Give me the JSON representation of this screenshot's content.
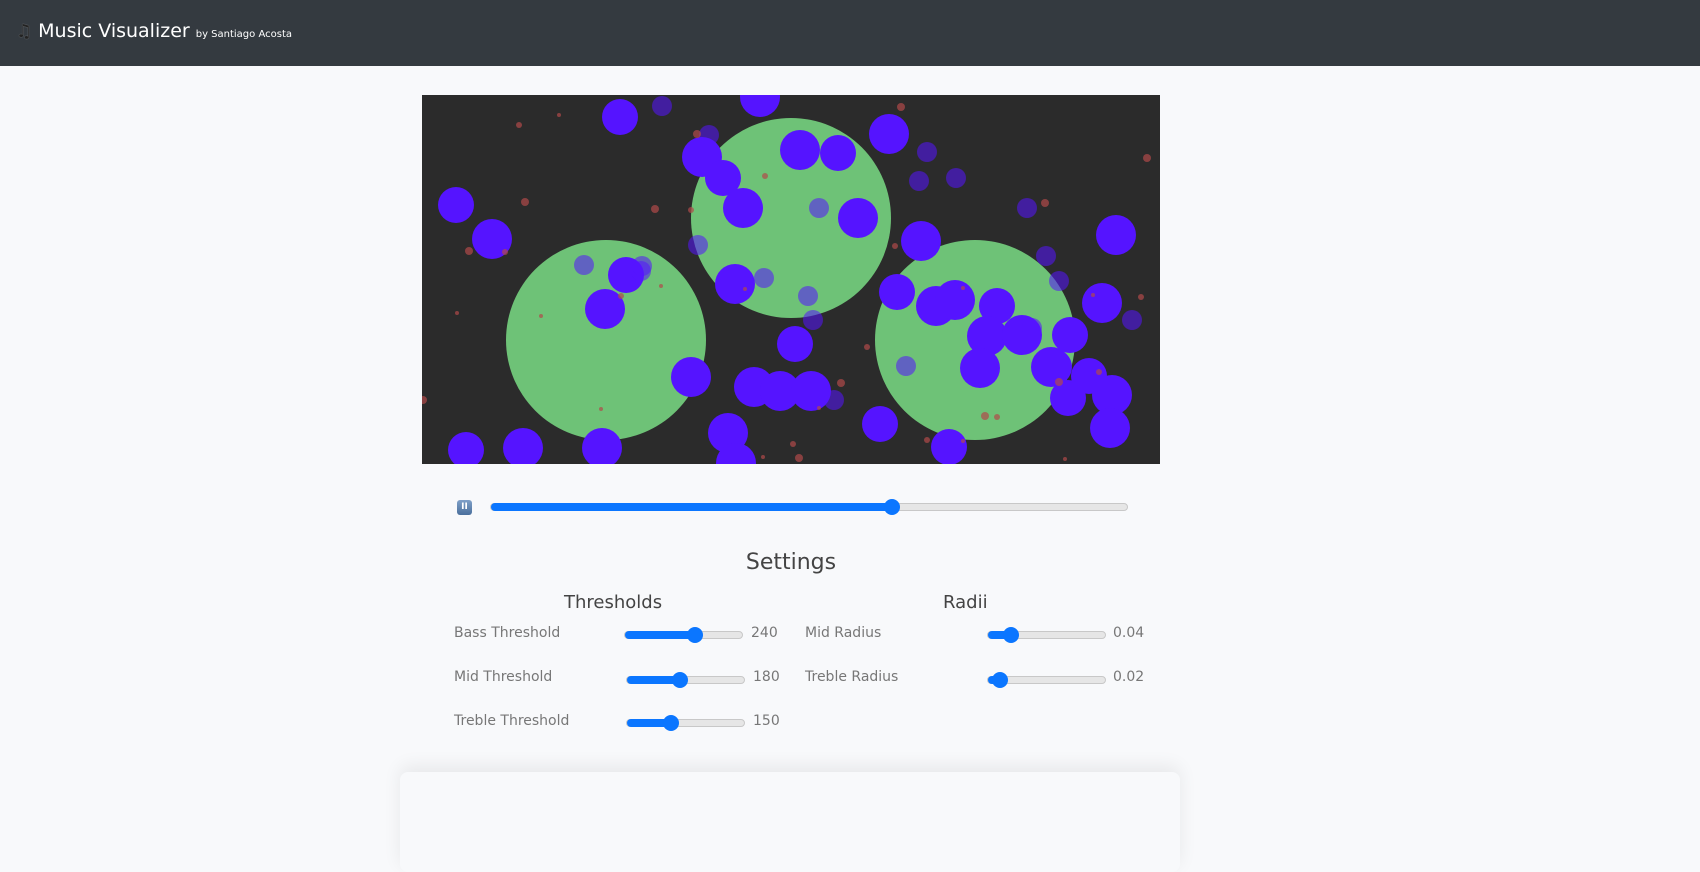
{
  "header": {
    "icon": "music-notes-icon",
    "title": "Music Visualizer",
    "byline": "by Santiago Acosta"
  },
  "player": {
    "pause_icon": "pause-icon",
    "pause_glyph": "II",
    "progress_percent": 63
  },
  "colors": {
    "canvas_bg": "#2b2b2b",
    "bass": "#6ec277",
    "mid": "#5514ff",
    "treble": "#b14a4a",
    "accent": "#0b76ff"
  },
  "settings": {
    "title": "Settings",
    "thresholds": {
      "title": "Thresholds",
      "items": [
        {
          "label": "Bass Threshold",
          "value": "240",
          "fraction": 0.6
        },
        {
          "label": "Mid Threshold",
          "value": "180",
          "fraction": 0.45
        },
        {
          "label": "Treble Threshold",
          "value": "150",
          "fraction": 0.375
        }
      ]
    },
    "radii": {
      "title": "Radii",
      "items": [
        {
          "label": "Mid Radius",
          "value": "0.04",
          "fraction": 0.2
        },
        {
          "label": "Treble Radius",
          "value": "0.02",
          "fraction": 0.1
        }
      ]
    }
  }
}
